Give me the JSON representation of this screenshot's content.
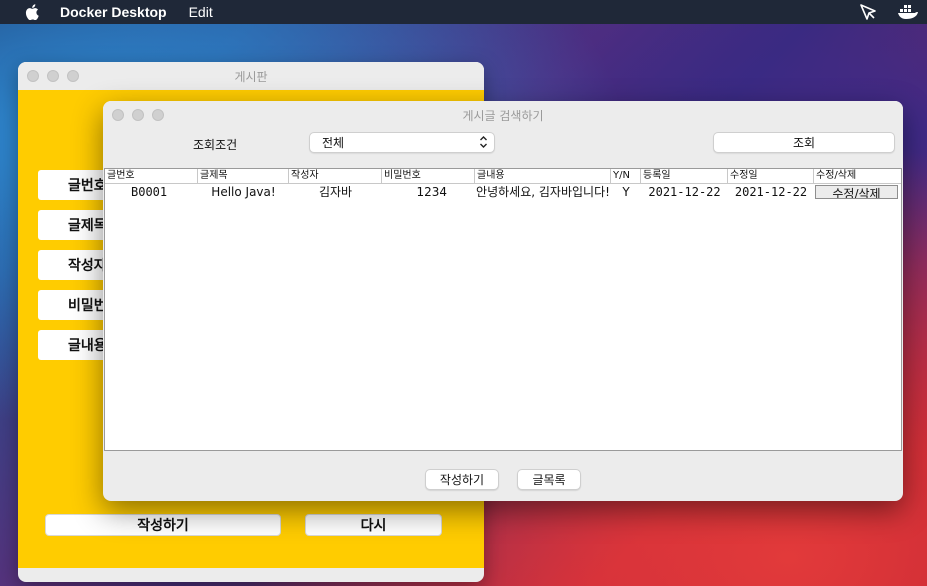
{
  "menubar": {
    "app_name": "Docker Desktop",
    "menu_edit": "Edit"
  },
  "back_window": {
    "title": "게시판",
    "side_buttons": [
      "글번호",
      "글제목",
      "작성자",
      "비밀번호",
      "글내용"
    ],
    "write_button": "작성하기",
    "again_button": "다시",
    "bg_color": "#ffcc00"
  },
  "search_window": {
    "title": "게시글 검색하기",
    "condition_label": "조회조건",
    "condition_selected": "전체",
    "search_button": "조회",
    "columns": [
      "글번호",
      "글제목",
      "작성자",
      "비밀번호",
      "글내용",
      "Y/N",
      "등록일",
      "수정일",
      "수정/삭제"
    ],
    "rows": [
      {
        "no": "B0001",
        "title": "Hello Java!",
        "writer": "김자바",
        "password": "1234",
        "content": "안녕하세요, 김자바입니다!",
        "yn": "Y",
        "reg_date": "2021-12-22",
        "mod_date": "2021-12-22",
        "action": "수정/삭제"
      }
    ],
    "write_button": "작성하기",
    "list_button": "글목록"
  }
}
